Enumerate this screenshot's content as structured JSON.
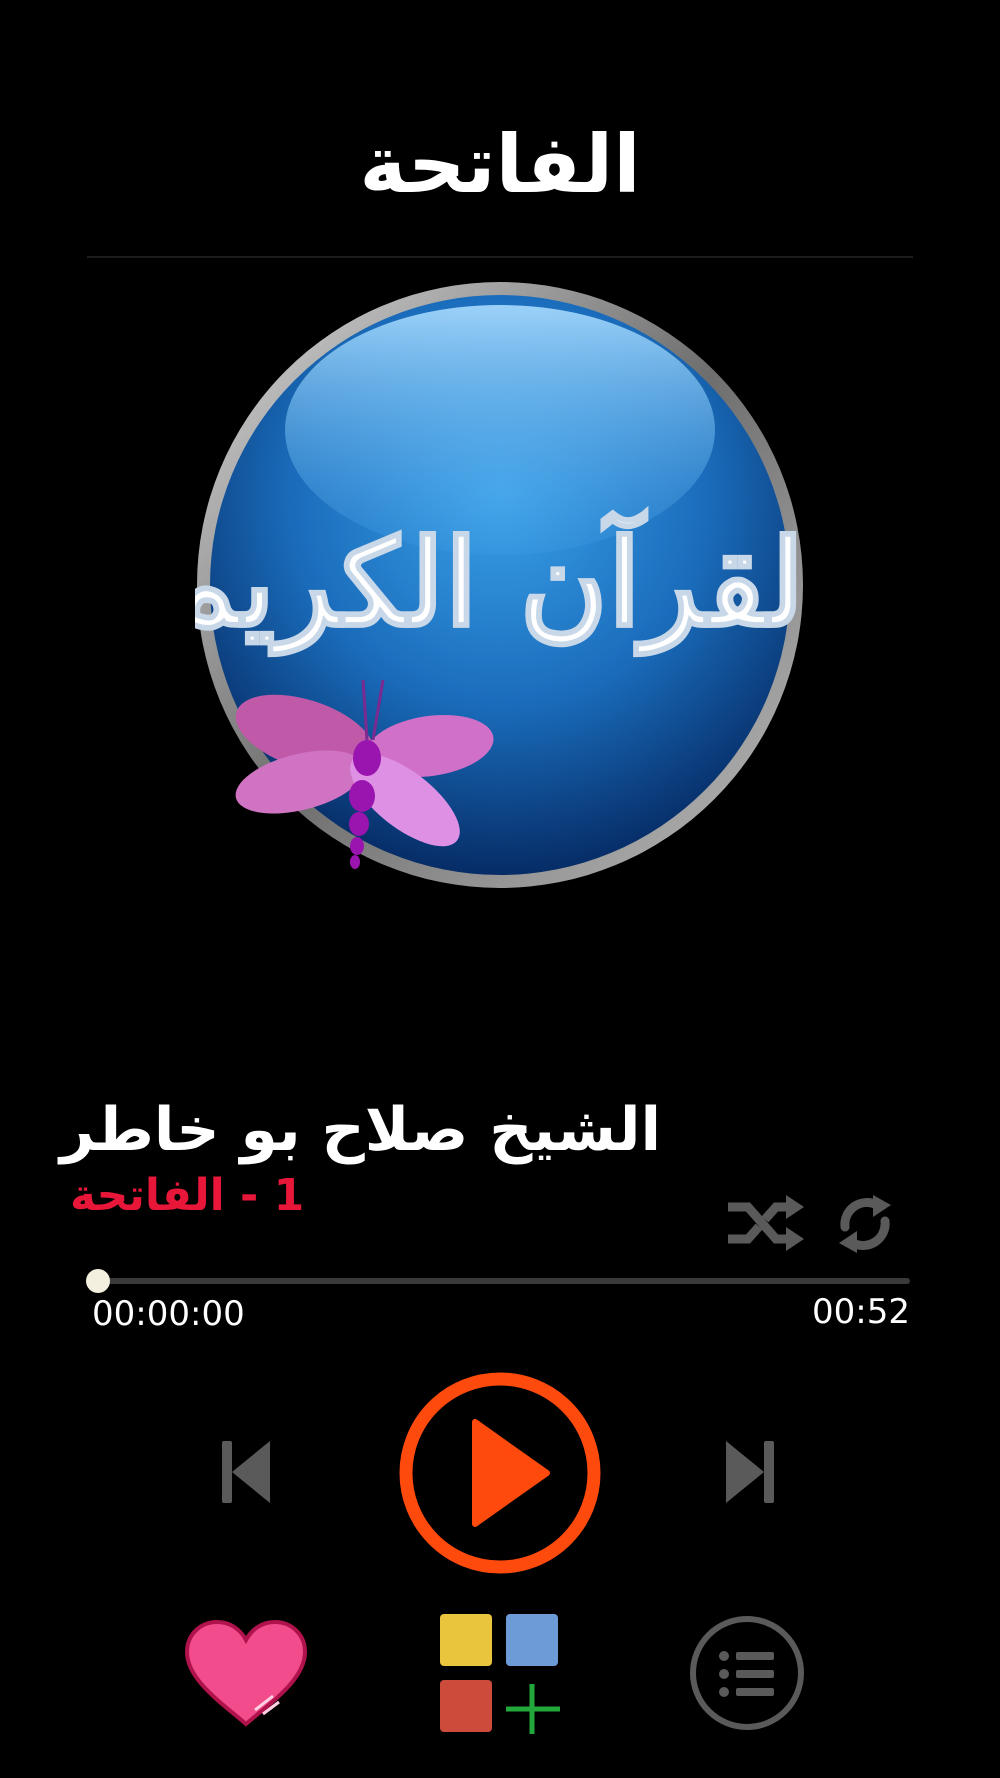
{
  "header": {
    "title": "الفاتحة"
  },
  "artwork": {
    "calligraphy_text": "القرآن الكريم"
  },
  "now_playing": {
    "reciter": "الشيخ صلاح بو خاطر",
    "track": "1 - الفاتحة",
    "track_color": "#e8173a"
  },
  "player": {
    "current_time": "00:00:00",
    "total_time": "00:52",
    "progress": 0.0
  },
  "controls": {
    "shuffle_icon": "shuffle-icon",
    "repeat_icon": "repeat-icon",
    "prev_icon": "skip-previous-icon",
    "play_icon": "play-icon",
    "next_icon": "skip-next-icon",
    "favorite_icon": "heart-icon",
    "apps_icon": "more-apps-icon",
    "playlist_icon": "playlist-icon"
  },
  "colors": {
    "accent": "#ff4a0d",
    "favorite": "#f24c8c",
    "icon_gray": "#5a5a5a"
  }
}
